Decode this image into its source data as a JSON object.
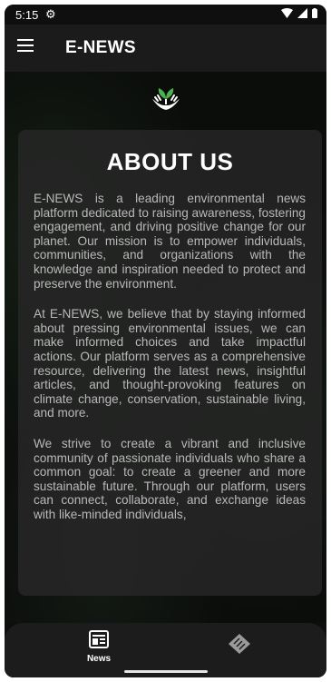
{
  "status": {
    "time": "5:15"
  },
  "appbar": {
    "title": "E-NEWS"
  },
  "about": {
    "heading": "ABOUT US",
    "paragraphs": [
      "E-NEWS is a leading environmental news platform dedicated to raising awareness, fostering engagement, and driving positive change for our planet. Our mission is to empower individuals, communities, and organizations with the knowledge and inspiration needed to protect and preserve the environment.",
      "At E-NEWS, we believe that by staying informed about pressing environmental issues, we can make informed choices and take impactful actions. Our platform serves as a comprehensive resource, delivering the latest news, insightful articles, and thought-provoking features on climate change, conservation, sustainable living, and more.",
      "We strive to create a vibrant and inclusive community of passionate individuals who share a common goal: to create a greener and more sustainable future. Through our platform, users can connect, collaborate, and exchange ideas with like-minded individuals,"
    ]
  },
  "bottom_nav": {
    "news_label": "News"
  },
  "icons": {
    "gear": "settings-gear-icon",
    "wifi": "wifi-icon",
    "signal": "signal-icon",
    "battery": "battery-icon",
    "menu": "hamburger-menu-icon",
    "logo": "plant-in-hands-logo",
    "news": "newspaper-icon",
    "other": "tag-diamond-icon"
  },
  "colors": {
    "background": "#0b0d0b",
    "card": "#282828",
    "appbar": "#1b1b1b",
    "text": "#b9b9b9"
  }
}
